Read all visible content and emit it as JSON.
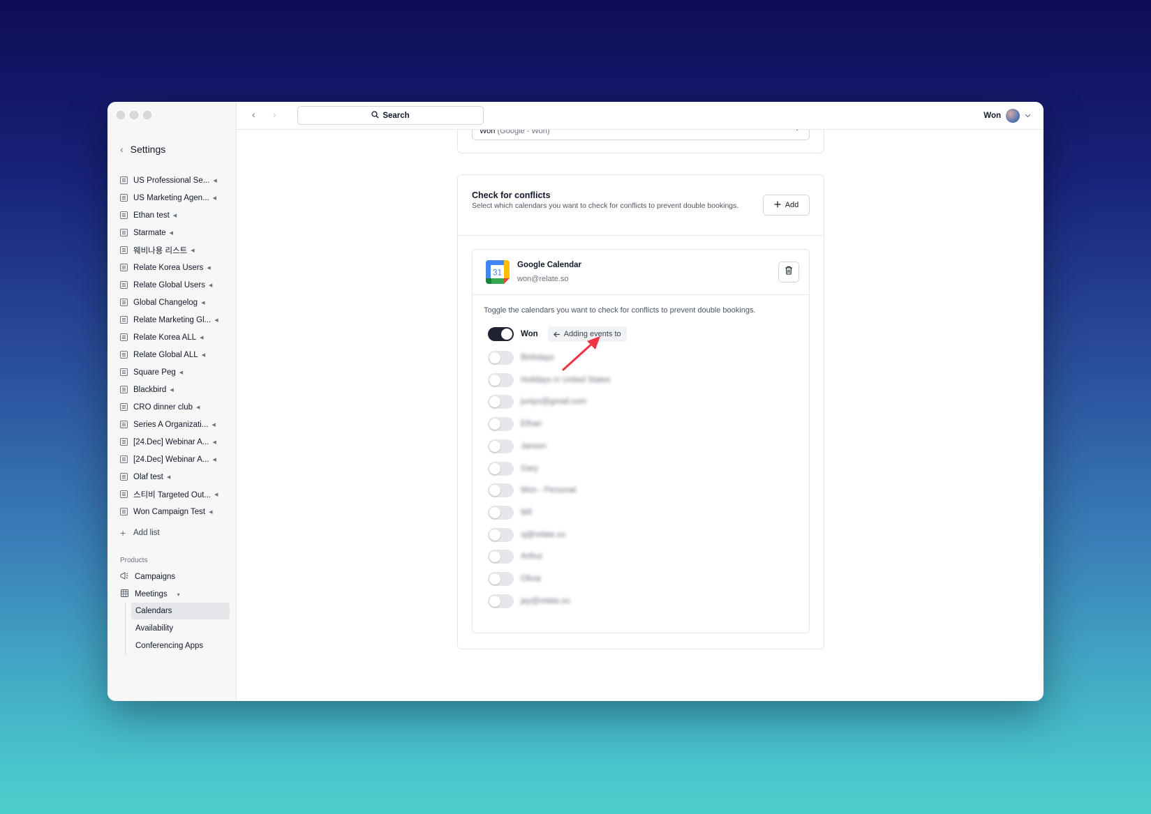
{
  "sidebar": {
    "title": "Settings",
    "lists": [
      "US Professional Se...",
      "US Marketing Agen...",
      "Ethan test",
      "Starmate",
      "웨비나용 리스트",
      "Relate Korea Users",
      "Relate Global Users",
      "Global Changelog",
      "Relate Marketing Gl...",
      "Relate Korea ALL",
      "Relate Global ALL",
      "Square Peg",
      "Blackbird",
      "CRO dinner club",
      "Series A Organizati...",
      "[24.Dec] Webinar A...",
      "[24.Dec] Webinar A...",
      "Olaf test",
      "스티비 Targeted Out...",
      "Won Campaign Test"
    ],
    "add_list": "Add list",
    "products_label": "Products",
    "campaigns": "Campaigns",
    "meetings": "Meetings",
    "meetings_sub": [
      "Calendars",
      "Availability",
      "Conferencing Apps"
    ],
    "active_sub": "Calendars"
  },
  "topbar": {
    "search": "Search",
    "user": "Won"
  },
  "top_select": {
    "value": "Won",
    "muted": "(Google - Won)"
  },
  "conflicts": {
    "title": "Check for conflicts",
    "description": "Select which calendars you want to check for conflicts to prevent double bookings.",
    "add_button": "Add"
  },
  "google_calendar": {
    "name": "Google Calendar",
    "email": "won@relate.so",
    "logo_day": "31",
    "description": "Toggle the calendars you want to check for conflicts to prevent double bookings.",
    "calendars": [
      {
        "name": "Won",
        "on": true,
        "badge": "Adding events to"
      },
      {
        "name": "Birthdays",
        "on": false
      },
      {
        "name": "Holidays in United States",
        "on": false
      },
      {
        "name": "juniyo@gmail.com",
        "on": false
      },
      {
        "name": "Ethan",
        "on": false
      },
      {
        "name": "Jansen",
        "on": false
      },
      {
        "name": "Gary",
        "on": false
      },
      {
        "name": "Won - Personal",
        "on": false
      },
      {
        "name": "Wil",
        "on": false
      },
      {
        "name": "sj@relate.so",
        "on": false
      },
      {
        "name": "Arthur",
        "on": false
      },
      {
        "name": "Olivia",
        "on": false
      },
      {
        "name": "jay@relate.so",
        "on": false
      }
    ]
  },
  "colors": {
    "toggle_on": "#1f2233",
    "annotation_arrow": "#ef3340"
  }
}
